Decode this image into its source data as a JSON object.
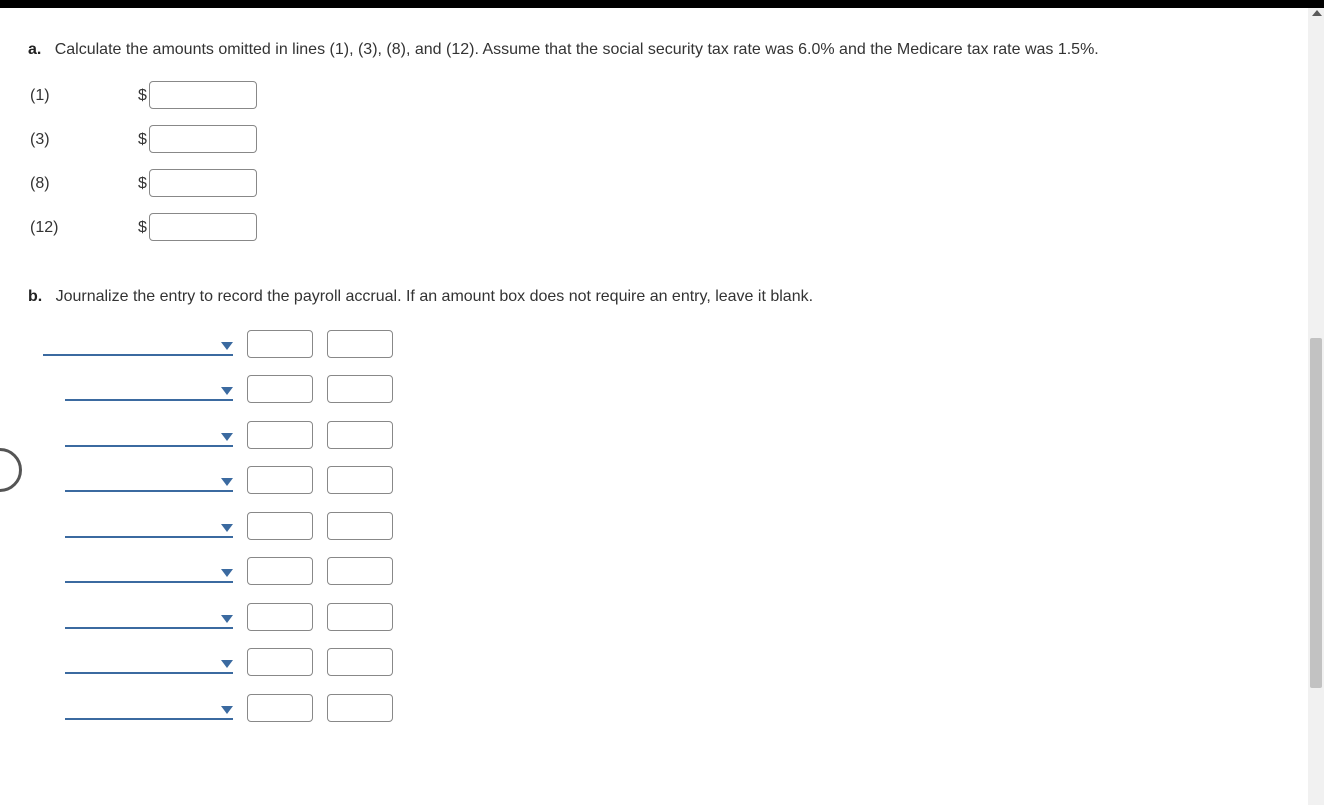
{
  "partA": {
    "label": "a.",
    "text": "Calculate the amounts omitted in lines (1), (3), (8), and (12). Assume that the social security tax rate was 6.0% and the Medicare tax rate was 1.5%.",
    "currency": "$",
    "lines": [
      {
        "label": "(1)",
        "value": ""
      },
      {
        "label": "(3)",
        "value": ""
      },
      {
        "label": "(8)",
        "value": ""
      },
      {
        "label": "(12)",
        "value": ""
      }
    ]
  },
  "partB": {
    "label": "b.",
    "text": "Journalize the entry to record the payroll accrual. If an amount box does not require an entry, leave it blank.",
    "rows": [
      {
        "indent": false,
        "account": "",
        "debit": "",
        "credit": ""
      },
      {
        "indent": true,
        "account": "",
        "debit": "",
        "credit": ""
      },
      {
        "indent": true,
        "account": "",
        "debit": "",
        "credit": ""
      },
      {
        "indent": true,
        "account": "",
        "debit": "",
        "credit": ""
      },
      {
        "indent": true,
        "account": "",
        "debit": "",
        "credit": ""
      },
      {
        "indent": true,
        "account": "",
        "debit": "",
        "credit": ""
      },
      {
        "indent": true,
        "account": "",
        "debit": "",
        "credit": ""
      },
      {
        "indent": true,
        "account": "",
        "debit": "",
        "credit": ""
      },
      {
        "indent": true,
        "account": "",
        "debit": "",
        "credit": ""
      }
    ]
  }
}
